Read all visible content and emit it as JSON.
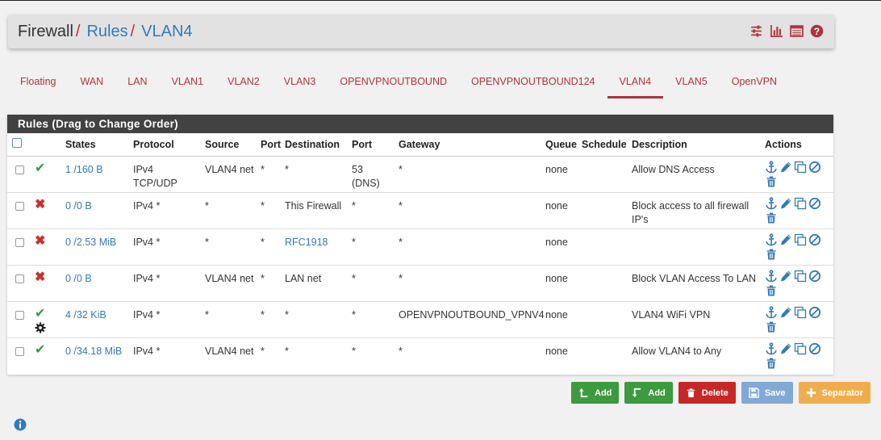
{
  "breadcrumb": {
    "root": "Firewall",
    "separator": "/",
    "rules": "Rules",
    "current": "VLAN4"
  },
  "header_icons": [
    "sliders-icon",
    "bar-chart-icon",
    "table-icon",
    "help-icon"
  ],
  "tabs": [
    {
      "label": "Floating"
    },
    {
      "label": "WAN"
    },
    {
      "label": "LAN"
    },
    {
      "label": "VLAN1"
    },
    {
      "label": "VLAN2"
    },
    {
      "label": "VLAN3"
    },
    {
      "label": "OPENVPNOUTBOUND"
    },
    {
      "label": "OPENVPNOUTBOUND124"
    },
    {
      "label": "VLAN4",
      "active": true
    },
    {
      "label": "VLAN5"
    },
    {
      "label": "OpenVPN"
    }
  ],
  "panel": {
    "title": "Rules (Drag to Change Order)"
  },
  "columns": {
    "states": "States",
    "protocol": "Protocol",
    "source": "Source",
    "port": "Port",
    "destination": "Destination",
    "dport": "Port",
    "gateway": "Gateway",
    "queue": "Queue",
    "schedule": "Schedule",
    "description": "Description",
    "actions": "Actions"
  },
  "rules": [
    {
      "status": "pass",
      "states": "1 /160 B",
      "protocol": "IPv4 TCP/UDP",
      "source": "VLAN4 net",
      "sport": "*",
      "destination": "*",
      "dport": "53 (DNS)",
      "gateway": "*",
      "queue": "none",
      "schedule": "",
      "description": "Allow DNS Access"
    },
    {
      "status": "block",
      "states": "0 /0 B",
      "protocol": "IPv4 *",
      "source": "*",
      "sport": "*",
      "destination": "This Firewall",
      "dport": "*",
      "gateway": "*",
      "queue": "none",
      "schedule": "",
      "description": "Block access to all firewall IP's"
    },
    {
      "status": "block",
      "states": "0 /2.53 MiB",
      "protocol": "IPv4 *",
      "source": "*",
      "sport": "*",
      "destination": "RFC1918",
      "destination_link": true,
      "dport": "*",
      "gateway": "*",
      "queue": "none",
      "schedule": "",
      "description": ""
    },
    {
      "status": "block",
      "states": "0 /0 B",
      "protocol": "IPv4 *",
      "source": "VLAN4 net",
      "sport": "*",
      "destination": "LAN net",
      "dport": "*",
      "gateway": "*",
      "queue": "none",
      "schedule": "",
      "description": "Block VLAN Access To LAN"
    },
    {
      "status": "pass",
      "advanced": true,
      "states": "4 /32 KiB",
      "protocol": "IPv4 *",
      "source": "*",
      "sport": "*",
      "destination": "*",
      "dport": "*",
      "gateway": "OPENVPNOUTBOUND_VPNV4",
      "queue": "none",
      "schedule": "",
      "description": "VLAN4 WiFi VPN"
    },
    {
      "status": "pass",
      "states": "0 /34.18 MiB",
      "protocol": "IPv4 *",
      "source": "VLAN4 net",
      "sport": "*",
      "destination": "*",
      "dport": "*",
      "gateway": "*",
      "queue": "none",
      "schedule": "",
      "description": "Allow VLAN4 to Any"
    }
  ],
  "row_actions": [
    "anchor-icon",
    "pencil-icon",
    "copy-icon",
    "disable-icon",
    "trash-icon"
  ],
  "buttons": {
    "add_top": "Add",
    "add_bottom": "Add",
    "delete": "Delete",
    "save": "Save",
    "separator": "Separator"
  },
  "colors": {
    "accent": "#b0333a",
    "link": "#337ab7",
    "panel_header": "#424242",
    "pass": "#2e9e3f",
    "block": "#c9302c",
    "btn_green": "#3c9a3f",
    "btn_red": "#c62828",
    "btn_blue": "#80a9d4",
    "btn_orange": "#f0ad4e"
  }
}
